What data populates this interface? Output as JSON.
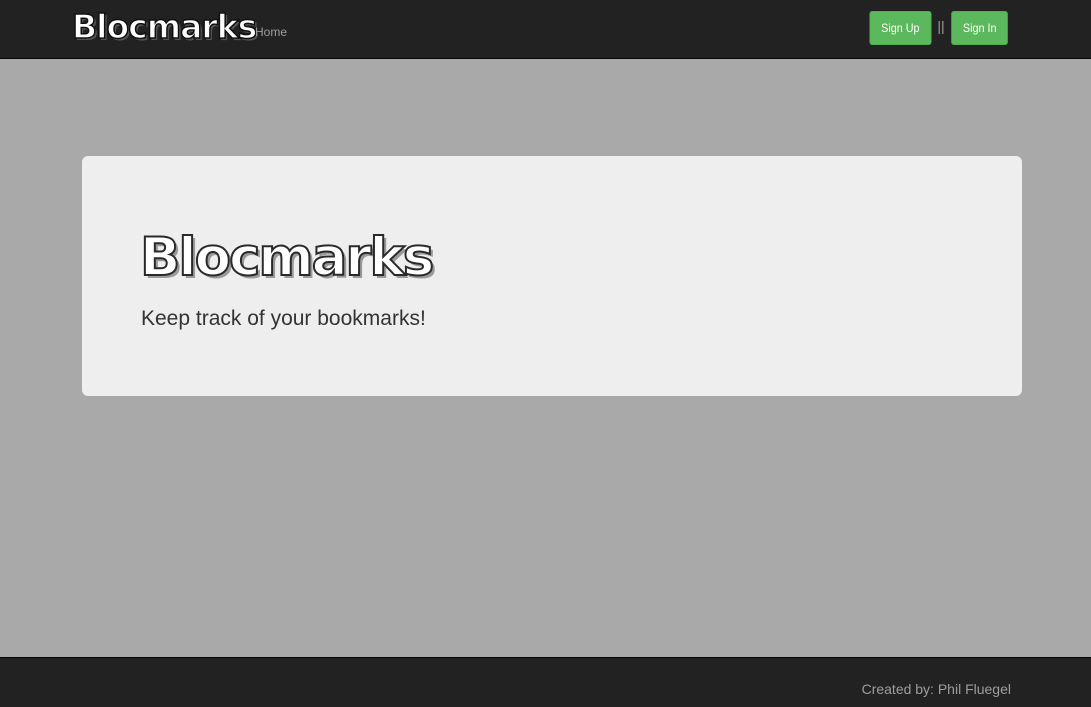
{
  "navbar": {
    "brand": "Blocmarks",
    "links": [
      {
        "label": "Home"
      }
    ],
    "auth": {
      "sign_up": "Sign Up",
      "separator": "||",
      "sign_in": "Sign In"
    }
  },
  "jumbotron": {
    "title": "Blocmarks",
    "tagline": "Keep track of your bookmarks!"
  },
  "footer": {
    "credit": "Created by: Phil Fluegel"
  },
  "colors": {
    "navbar_bg": "#222222",
    "page_bg": "#a9a9a9",
    "panel_bg": "#eeeeee",
    "button_green": "#5cb85c",
    "nav_text": "#9d9d9d"
  }
}
